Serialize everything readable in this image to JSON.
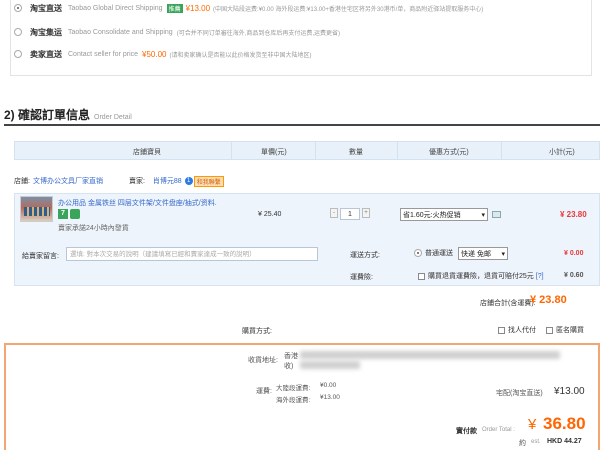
{
  "shipping": {
    "options": [
      {
        "name": "淘宝直送",
        "en": "Taobao Global Direct Shipping",
        "tag": "推薦",
        "price": "¥13.00",
        "note": "(中国大陆段运费:¥0.00 海外段运费:¥13.00+香港住宅区将另外30港币/单，商品附近驿站提取服务中心)",
        "selected": true
      },
      {
        "name": "淘宝集运",
        "en": "Taobao Consolidate and Shipping",
        "note": "(可合并不同订单審往海外,商品到仓库后再支付运费,运费更省)",
        "selected": false
      },
      {
        "name": "卖家直送",
        "en": "Contact seller for price",
        "price": "¥50.00",
        "note": "(请和卖家确认是否能以此价格发货至非中国大陆地区)",
        "selected": false
      }
    ]
  },
  "order": {
    "section_no": "2)",
    "title": "確認訂單信息",
    "title_en": "Order Detail",
    "headers": {
      "item": "店鋪寶貝",
      "price": "單價(元)",
      "qty": "數量",
      "promo": "優惠方式(元)",
      "subtotal": "小計(元)"
    },
    "store_label": "店鋪:",
    "store_name": "文博办公文具厂家直销",
    "seller_label": "賣家:",
    "seller_name": "肖博元88",
    "seller_badge_icon": "1",
    "seller_badge": "和我聯繫",
    "item": {
      "title": "办公用品 金属铁丝 四层文件架/文件盘座/抽式/资料.",
      "tag_icon": "7",
      "promise": "賣家承諾24小時內發貨",
      "price": "¥ 25.40",
      "qty": "1",
      "qty_minus": "-",
      "qty_plus": "+",
      "promo": "省1.60元:火热促销",
      "subtotal": "¥ 23.80"
    },
    "message_label": "給賣家留言:",
    "message_placeholder": "選填: 對本次交易的說明（建議填寫已經和賣家達成一致的說明）",
    "delivery_label": "運送方式:",
    "delivery_option": "普通運送",
    "delivery_select": "快递 免邮",
    "delivery_price": "¥ 0.00",
    "insurance_label": "運費險:",
    "insurance_text": "購買退貨運費險，退貨可賠付25元",
    "insurance_help": "[?]",
    "insurance_price": "¥ 0.60",
    "store_total_label": "店鋪合計(含運費):",
    "store_total": "¥ 23.80",
    "payment_label": "購買方式:",
    "payment_proxy": "找人代付",
    "payment_anon": "匿名購買"
  },
  "summary": {
    "address_label": "收貨地址:",
    "address_text": "香港",
    "address_text2": "收)",
    "freight_label": "運費:",
    "mainland_freight": "大陸段運費:",
    "mainland_value": "¥0.00",
    "overseas_freight": "海外段運費:",
    "overseas_value": "¥13.00",
    "ship_method": "宅配(淘宝直送)",
    "ship_price": "¥13.00",
    "total_label": "實付款",
    "total_en": "Order Total :",
    "total_currency": "¥",
    "total": "36.80",
    "est_prefix": "約",
    "est_label": "est.",
    "est_value": "HKD 44.27"
  },
  "colors": {
    "accent_orange": "#ff6600",
    "price_red": "#e4393c",
    "link_blue": "#3366cc",
    "header_bg": "#e8f1fa"
  }
}
